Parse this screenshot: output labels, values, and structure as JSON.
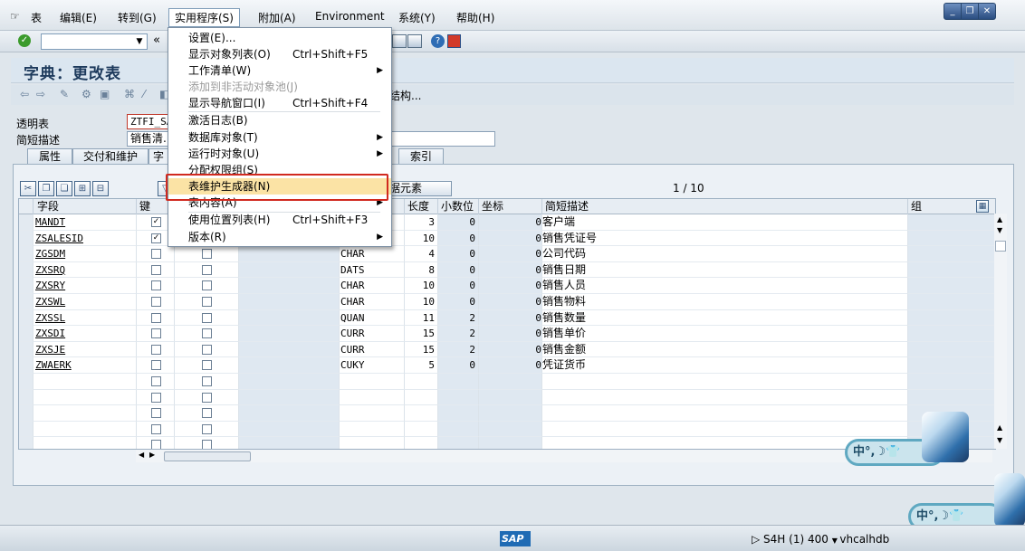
{
  "menubar": {
    "items": [
      "表",
      "编辑(E)",
      "转到(G)",
      "实用程序(S)",
      "附加(A)",
      "Environment",
      "系统(Y)",
      "帮助(H)"
    ],
    "active_index": 3
  },
  "window_controls": [
    "_",
    "❐",
    "✕"
  ],
  "page_title": "字典：更改表",
  "toolbar_partial_text": "和结构...",
  "header": {
    "table_label": "透明表",
    "table_value": "ZTFI_SA",
    "desc_label": "简短描述",
    "desc_value": "销售清..."
  },
  "tabs": [
    "属性",
    "交付和维护",
    "字",
    "索引"
  ],
  "data_element_button": "据元素",
  "pager": "1 / 10",
  "grid": {
    "headers": [
      "字段",
      "键",
      "",
      "",
      "",
      "长度",
      "小数位",
      "坐标",
      "简短描述",
      "组"
    ],
    "rows": [
      {
        "field": "MANDT",
        "key": true,
        "type": "",
        "len": "3",
        "dec": "0",
        "coord": "0",
        "desc": "客户端"
      },
      {
        "field": "ZSALESID",
        "key": true,
        "type": "",
        "len": "10",
        "dec": "0",
        "coord": "0",
        "desc": "销售凭证号"
      },
      {
        "field": "ZGSDM",
        "key": false,
        "type": "CHAR",
        "len": "4",
        "dec": "0",
        "coord": "0",
        "desc": "公司代码"
      },
      {
        "field": "ZXSRQ",
        "key": false,
        "type": "DATS",
        "len": "8",
        "dec": "0",
        "coord": "0",
        "desc": "销售日期"
      },
      {
        "field": "ZXSRY",
        "key": false,
        "type": "CHAR",
        "len": "10",
        "dec": "0",
        "coord": "0",
        "desc": "销售人员"
      },
      {
        "field": "ZXSWL",
        "key": false,
        "type": "CHAR",
        "len": "10",
        "dec": "0",
        "coord": "0",
        "desc": "销售物料"
      },
      {
        "field": "ZXSSL",
        "key": false,
        "type": "QUAN",
        "len": "11",
        "dec": "2",
        "coord": "0",
        "desc": "销售数量"
      },
      {
        "field": "ZXSDI",
        "key": false,
        "type": "CURR",
        "len": "15",
        "dec": "2",
        "coord": "0",
        "desc": "销售单价"
      },
      {
        "field": "ZXSJE",
        "key": false,
        "type": "CURR",
        "len": "15",
        "dec": "2",
        "coord": "0",
        "desc": "销售金额"
      },
      {
        "field": "ZWAERK",
        "key": false,
        "type": "CUKY",
        "len": "5",
        "dec": "0",
        "coord": "0",
        "desc": "凭证货币"
      }
    ],
    "empty_rows": 5
  },
  "dropdown": {
    "items": [
      {
        "label": "设置(E)...",
        "shortcut": "",
        "arrow": false,
        "disabled": false,
        "highlight": false
      },
      {
        "label": "显示对象列表(O)",
        "shortcut": "Ctrl+Shift+F5",
        "arrow": false,
        "disabled": false,
        "highlight": false
      },
      {
        "label": "工作清单(W)",
        "shortcut": "",
        "arrow": true,
        "disabled": false,
        "highlight": false
      },
      {
        "label": "添加到非活动对象池(J)",
        "shortcut": "",
        "arrow": false,
        "disabled": true,
        "highlight": false
      },
      {
        "label": "显示导航窗口(I)",
        "shortcut": "Ctrl+Shift+F4",
        "arrow": false,
        "disabled": false,
        "highlight": false
      },
      {
        "label": "激活日志(B)",
        "shortcut": "",
        "arrow": false,
        "disabled": false,
        "highlight": false
      },
      {
        "label": "数据库对象(T)",
        "shortcut": "",
        "arrow": true,
        "disabled": false,
        "highlight": false
      },
      {
        "label": "运行时对象(U)",
        "shortcut": "",
        "arrow": true,
        "disabled": false,
        "highlight": false
      },
      {
        "label": "分配权限组(S)",
        "shortcut": "",
        "arrow": false,
        "disabled": false,
        "highlight": false
      },
      {
        "label": "表维护生成器(N)",
        "shortcut": "",
        "arrow": false,
        "disabled": false,
        "highlight": true
      },
      {
        "label": "表内容(A)",
        "shortcut": "",
        "arrow": true,
        "disabled": false,
        "highlight": false
      },
      {
        "label": "使用位置列表(H)",
        "shortcut": "Ctrl+Shift+F3",
        "arrow": false,
        "disabled": false,
        "highlight": false
      },
      {
        "label": "版本(R)",
        "shortcut": "",
        "arrow": true,
        "disabled": false,
        "highlight": false
      }
    ]
  },
  "status": {
    "logo": "SAP",
    "system": "S4H (1) 400",
    "server": "vhcalhdb"
  },
  "ime": {
    "label": "中°,☽👕"
  },
  "colors": {
    "accent": "#d12a1f",
    "highlight": "#fbe3a5",
    "title": "#1d3a5c"
  }
}
